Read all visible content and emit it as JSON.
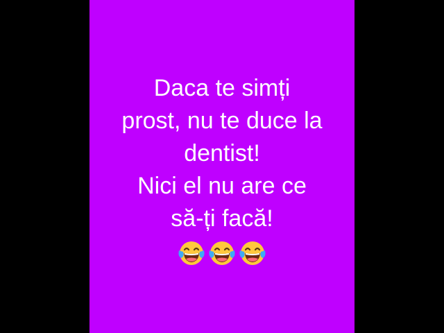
{
  "colors": {
    "background": "#000000",
    "panel": "#bf00ff",
    "text": "#ffffff"
  },
  "joke": {
    "lines": [
      "Daca te simți",
      "prost, nu te duce la",
      "dentist!",
      "Nici el nu are ce",
      "să-ți facă!"
    ]
  },
  "emojis": [
    {
      "icon": "face-with-tears-of-joy-icon"
    },
    {
      "icon": "face-with-tears-of-joy-icon"
    },
    {
      "icon": "face-with-tears-of-joy-icon"
    }
  ]
}
